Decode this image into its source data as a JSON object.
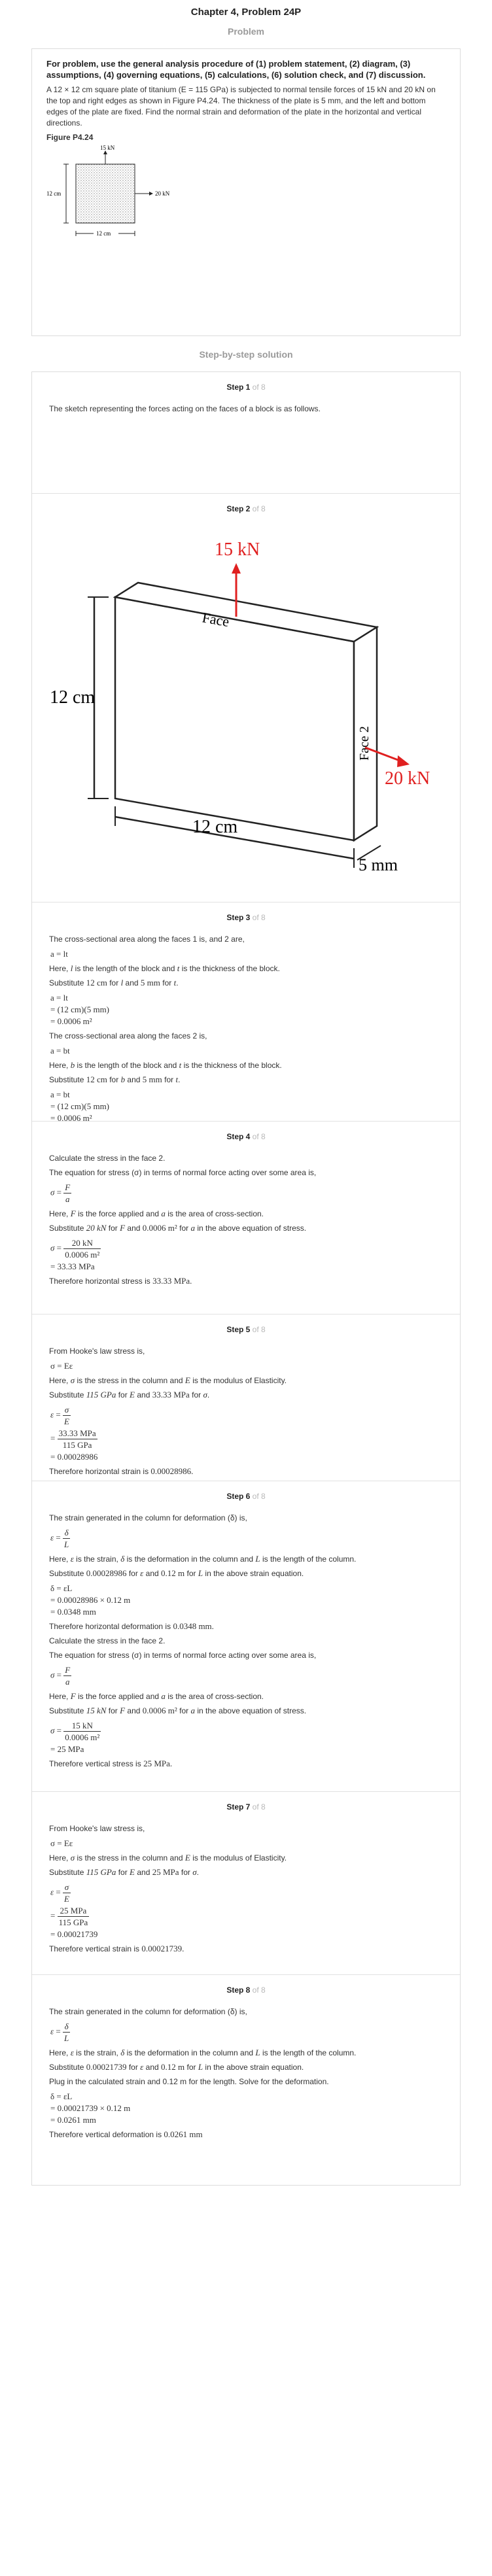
{
  "page_title": "Chapter 4, Problem 24P",
  "problem": {
    "heading": "Problem",
    "lead": "For problem, use the general analysis procedure of (1) problem statement, (2) diagram, (3) assumptions, (4) governing equations, (5) calculations, (6) solution check, and (7) discussion.",
    "statement": "A 12 × 12 cm square plate of titanium (E = 115 GPa) is subjected to normal tensile forces of 15 kN and 20 kN on the top and right edges as shown in Figure P4.24. The thickness of the plate is 5 mm, and the left and bottom edges of the plate are fixed. Find the normal strain and deformation of the plate in the horizontal and vertical directions.",
    "figure_label": "Figure P4.24",
    "figure": {
      "top_force": "15 kN",
      "right_force": "20 kN",
      "left_dim": "12 cm",
      "bottom_dim": "12 cm"
    }
  },
  "solution_heading": "Step-by-step solution",
  "steps": {
    "s1": {
      "num": "Step 1",
      "of": "of 8",
      "text": "The sketch representing the forces acting on the faces of a block is as follows."
    },
    "s2": {
      "num": "Step 2",
      "of": "of 8",
      "fig": {
        "top_force": "15 kN",
        "right_force": "20 kN",
        "face1": "Face",
        "face2": "Face 2",
        "height": "12 cm",
        "width": "12 cm",
        "thickness": "5 mm"
      }
    },
    "s3": {
      "num": "Step 3",
      "of": "of 8",
      "t1": "The cross-sectional area along the faces 1 is, and 2 are,",
      "f1": "a = lt",
      "t2a": "Here,",
      "t2b": "is the length of the block and",
      "t2c": "is the thickness of the block.",
      "t3a": "Substitute",
      "t3b": "12 cm",
      "t3c": "for",
      "t3d": "and",
      "t3e": "5 mm",
      "t3f": "for",
      "e1": "a = lt",
      "e2": "= (12 cm)(5 mm)",
      "e3": "= 0.0006 m²",
      "t4": "The cross-sectional area along the faces 2 is,",
      "f2": "a = bt",
      "t5a": "Here,",
      "t5b": "is the length of the block and",
      "t5c": "is the thickness of the block.",
      "t6a": "Substitute",
      "t6b": "12 cm",
      "t6c": "for",
      "t6d": "and",
      "t6e": "5 mm",
      "t6f": "for",
      "e4": "a = bt",
      "e5": "= (12 cm)(5 mm)",
      "e6": "= 0.0006 m²"
    },
    "s4": {
      "num": "Step 4",
      "of": "of 8",
      "t1": "Calculate the stress in the face 2.",
      "t2": "The equation for stress (σ) in terms of normal force acting over some area is,",
      "t3a": "Here,",
      "t3b": "is the force applied and",
      "t3c": "is the area of cross-section.",
      "t4a": "Substitute",
      "t4b": "20 kN",
      "t4c": "for",
      "t4d": "and",
      "t4e": "0.0006 m²",
      "t4f": "for",
      "t4g": "in the above equation of stress.",
      "num_v": "20 kN",
      "den_v": "0.0006 m²",
      "r": "= 33.33 MPa",
      "t5": "Therefore horizontal stress is",
      "ans": "33.33 MPa."
    },
    "s5": {
      "num": "Step 5",
      "of": "of 8",
      "t1": "From Hooke's law stress is,",
      "f1": "σ = Eε",
      "t2a": "Here,",
      "t2b": "is the stress in the column and",
      "t2c": "is the modulus of Elasticity.",
      "t3a": "Substitute",
      "t3b": "115 GPa",
      "t3c": "for",
      "t3d": "and",
      "t3e": "33.33 MPa",
      "t3f": "for",
      "num_v": "33.33 MPa",
      "den_v": "115 GPa",
      "r": "= 0.00028986",
      "t4": "Therefore horizontal strain is",
      "ans": "0.00028986."
    },
    "s6": {
      "num": "Step 6",
      "of": "of 8",
      "t1": "The strain generated in the column for deformation (δ) is,",
      "t2a": "Here,",
      "t2b": "is the strain,",
      "t2c": "is the deformation in the column and",
      "t2d": "is the length of the column.",
      "t3a": "Substitute",
      "t3b": "0.00028986",
      "t3c": "for",
      "t3d": "and",
      "t3e": "0.12 m",
      "t3f": "for",
      "t3g": "in the above strain equation.",
      "e1": "δ = εL",
      "e2": "= 0.00028986 × 0.12 m",
      "e3": "= 0.0348 mm",
      "t4": "Therefore horizontal deformation is",
      "ans1": "0.0348 mm.",
      "t5": "Calculate the stress in the face 2.",
      "t6": "The equation for stress (σ) in terms of normal force acting over some area is,",
      "t7a": "Here,",
      "t7b": "is the force applied and",
      "t7c": "is the area of cross-section.",
      "t8a": "Substitute",
      "t8b": "15 kN",
      "t8c": "for",
      "t8d": "and",
      "t8e": "0.0006 m²",
      "t8f": "for",
      "t8g": "in the above equation of stress.",
      "num_v": "15 kN",
      "den_v": "0.0006 m²",
      "r": "= 25 MPa",
      "t9": "Therefore vertical stress is",
      "ans2": "25 MPa."
    },
    "s7": {
      "num": "Step 7",
      "of": "of 8",
      "t1": "From Hooke's law stress is,",
      "f1": "σ = Eε",
      "t2a": "Here,",
      "t2b": "is the stress in the column and",
      "t2c": "is the modulus of Elasticity.",
      "t3a": "Substitute",
      "t3b": "115 GPa",
      "t3c": "for",
      "t3d": "and",
      "t3e": "25 MPa",
      "t3f": "for",
      "num_v": "25 MPa",
      "den_v": "115 GPa",
      "r": "= 0.00021739",
      "t4": "Therefore vertical strain is",
      "ans": "0.00021739."
    },
    "s8": {
      "num": "Step 8",
      "of": "of 8",
      "t1": "The strain generated in the column for deformation (δ) is,",
      "t2a": "Here,",
      "t2b": "is the strain,",
      "t2c": "is the deformation in the column and",
      "t2d": "is the length of the column.",
      "t3a": "Substitute",
      "t3b": "0.00021739",
      "t3c": "for",
      "t3d": "and",
      "t3e": "0.12 m",
      "t3f": "for",
      "t3g": "in the above strain equation.",
      "t4": "Plug in the calculated strain and 0.12 m for the length. Solve for the deformation.",
      "e1": "δ = εL",
      "e2": "= 0.00021739 × 0.12 m",
      "e3": "= 0.0261 mm",
      "t5": "Therefore vertical deformation is",
      "ans": "0.0261 mm"
    }
  },
  "colors": {
    "force_arrow": "#e02020",
    "border": "#dcdcdc",
    "muted": "#9a9a9a"
  }
}
